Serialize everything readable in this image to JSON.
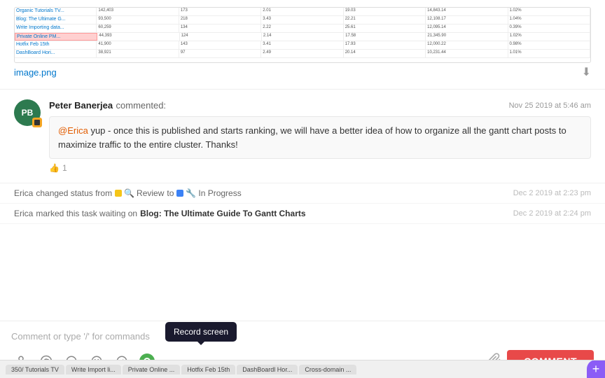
{
  "image": {
    "filename": "image.png",
    "download_tooltip": "Download"
  },
  "comment": {
    "author": "Peter Banerjea",
    "author_initials": "PB",
    "action": "commented:",
    "timestamp": "Nov 25 2019 at 5:46 am",
    "mention": "@Erica",
    "body": " yup - once this is published and starts ranking, we will have a better idea of how to organize all the gantt chart posts to maximize traffic to the entire cluster. Thanks!",
    "like_count": "1"
  },
  "status_changes": [
    {
      "actor": "Erica",
      "action": "changed status from",
      "from_status": "Review",
      "to_text": "to",
      "to_status": "In Progress",
      "timestamp": "Dec 2 2019 at 2:23 pm"
    },
    {
      "actor": "Erica",
      "action": "marked this task waiting on",
      "task": "Blog: The Ultimate Guide To Gantt Charts",
      "timestamp": "Dec 2 2019 at 2:24 pm"
    }
  ],
  "comment_input": {
    "placeholder": "Comment or type '/' for commands",
    "submit_label": "COMMENT"
  },
  "toolbar": {
    "icons": [
      "person",
      "at",
      "smile-outline",
      "emoji",
      "slash",
      "record"
    ],
    "tooltip": "Record screen",
    "attachment_icon": "paperclip"
  },
  "taskbar": {
    "tabs": [
      {
        "label": "350/ Tutorials TV",
        "active": false
      },
      {
        "label": "Write Import li...",
        "active": false
      },
      {
        "label": "Private Online ...",
        "active": false
      },
      {
        "label": "Hotfix Feb 15th",
        "active": false
      },
      {
        "label": "DashBoardl Hor...",
        "active": false
      },
      {
        "label": "Cross-domain ...",
        "active": false
      }
    ],
    "plus_label": "+"
  }
}
